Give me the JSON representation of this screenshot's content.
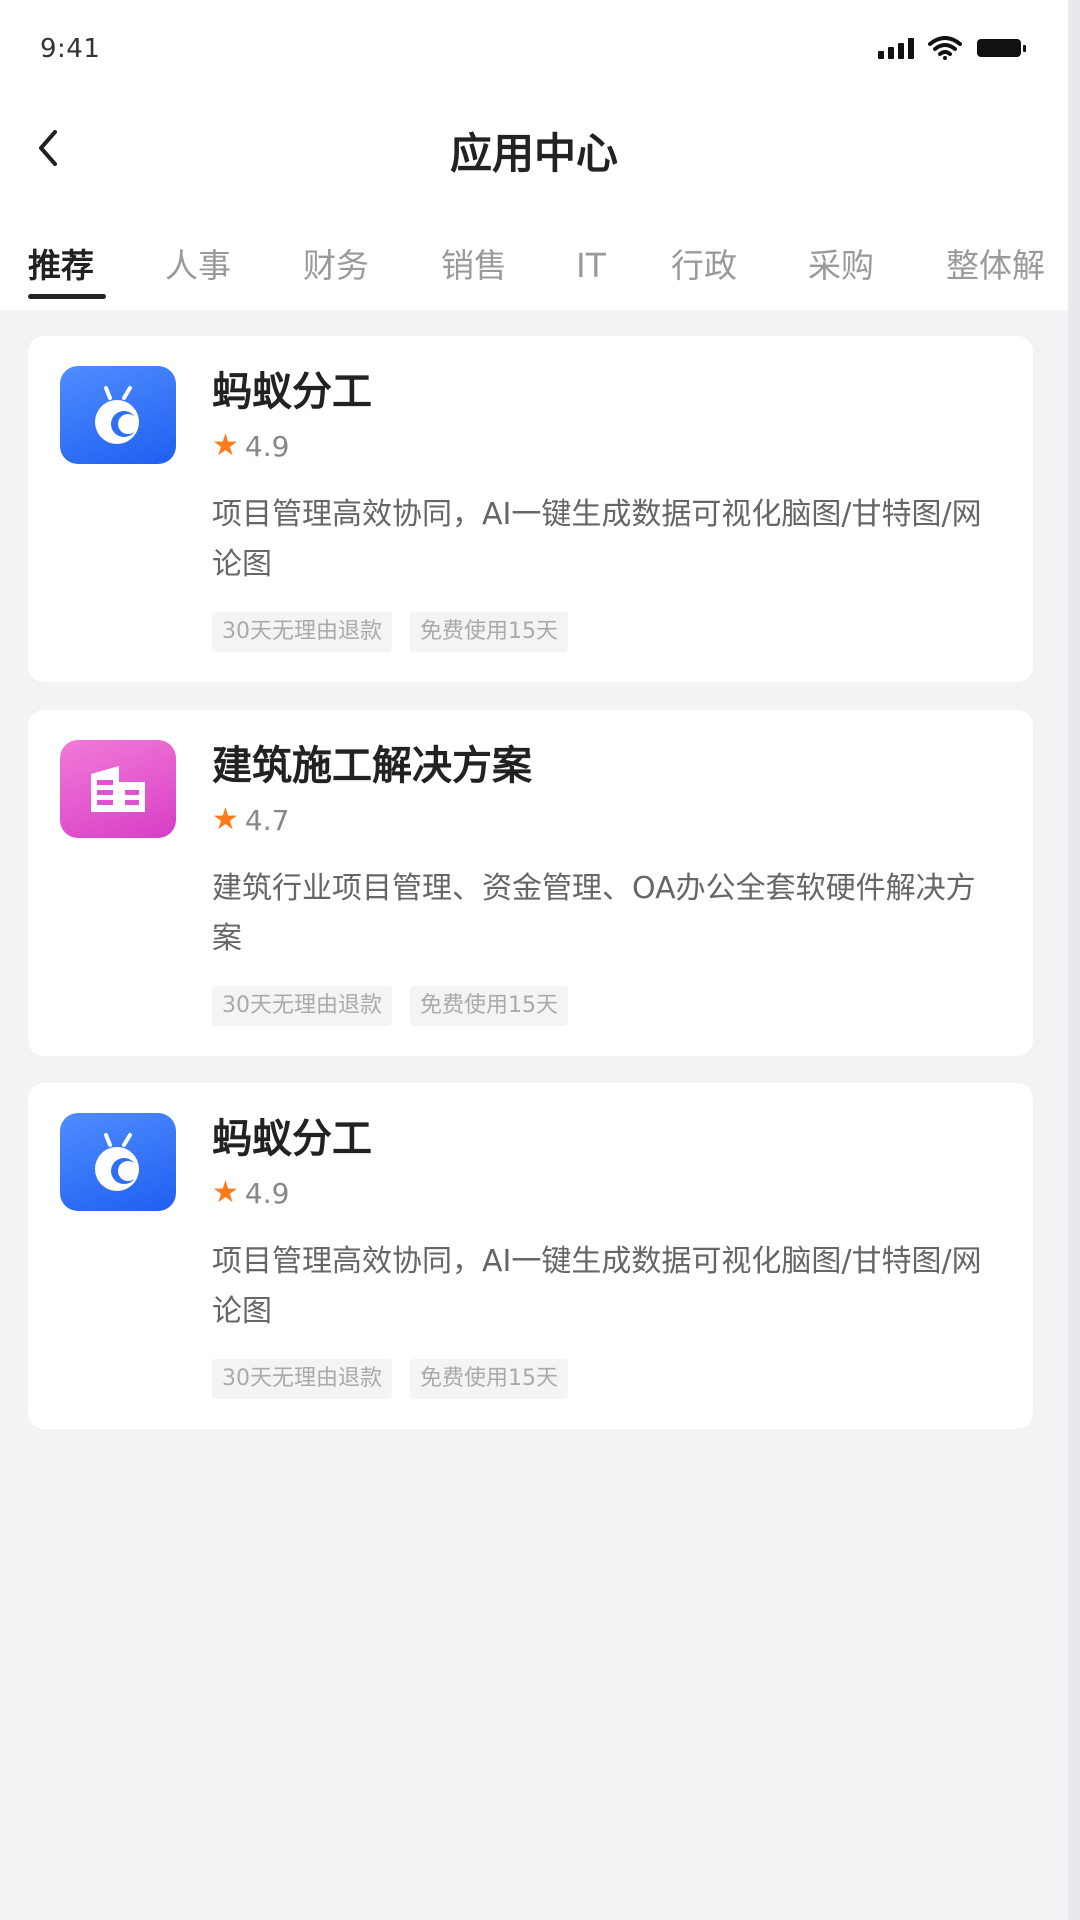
{
  "status_bar": {
    "time": "9:41",
    "signal_icon": "cellular-signal-icon",
    "wifi_icon": "wifi-icon",
    "battery_icon": "battery-icon"
  },
  "header": {
    "back_icon": "chevron-left-icon",
    "title": "应用中心"
  },
  "tabs": [
    {
      "label": "推荐",
      "active": true
    },
    {
      "label": "人事",
      "active": false
    },
    {
      "label": "财务",
      "active": false
    },
    {
      "label": "销售",
      "active": false
    },
    {
      "label": "IT",
      "active": false
    },
    {
      "label": "行政",
      "active": false
    },
    {
      "label": "采购",
      "active": false
    },
    {
      "label": "整体解",
      "active": false
    }
  ],
  "apps": [
    {
      "name": "蚂蚁分工",
      "icon": "ant-app-icon",
      "icon_color": "#2f6ff6",
      "rating": "4.9",
      "description": "项目管理高效协同，AI一键生成数据可视化脑图/甘特图/网论图",
      "tags": [
        "30天无理由退款",
        "免费使用15天"
      ]
    },
    {
      "name": "建筑施工解决方案",
      "icon": "building-icon",
      "icon_color": "#e052cf",
      "rating": "4.7",
      "description": "建筑行业项目管理、资金管理、OA办公全套软硬件解决方案",
      "tags": [
        "30天无理由退款",
        "免费使用15天"
      ]
    },
    {
      "name": "蚂蚁分工",
      "icon": "ant-app-icon",
      "icon_color": "#2f6ff6",
      "rating": "4.9",
      "description": "项目管理高效协同，AI一键生成数据可视化脑图/甘特图/网论图",
      "tags": [
        "30天无理由退款",
        "免费使用15天"
      ]
    }
  ],
  "colors": {
    "star": "#ff7a1a",
    "page_bg": "#f3f3f5",
    "active_tab": "#222222"
  }
}
